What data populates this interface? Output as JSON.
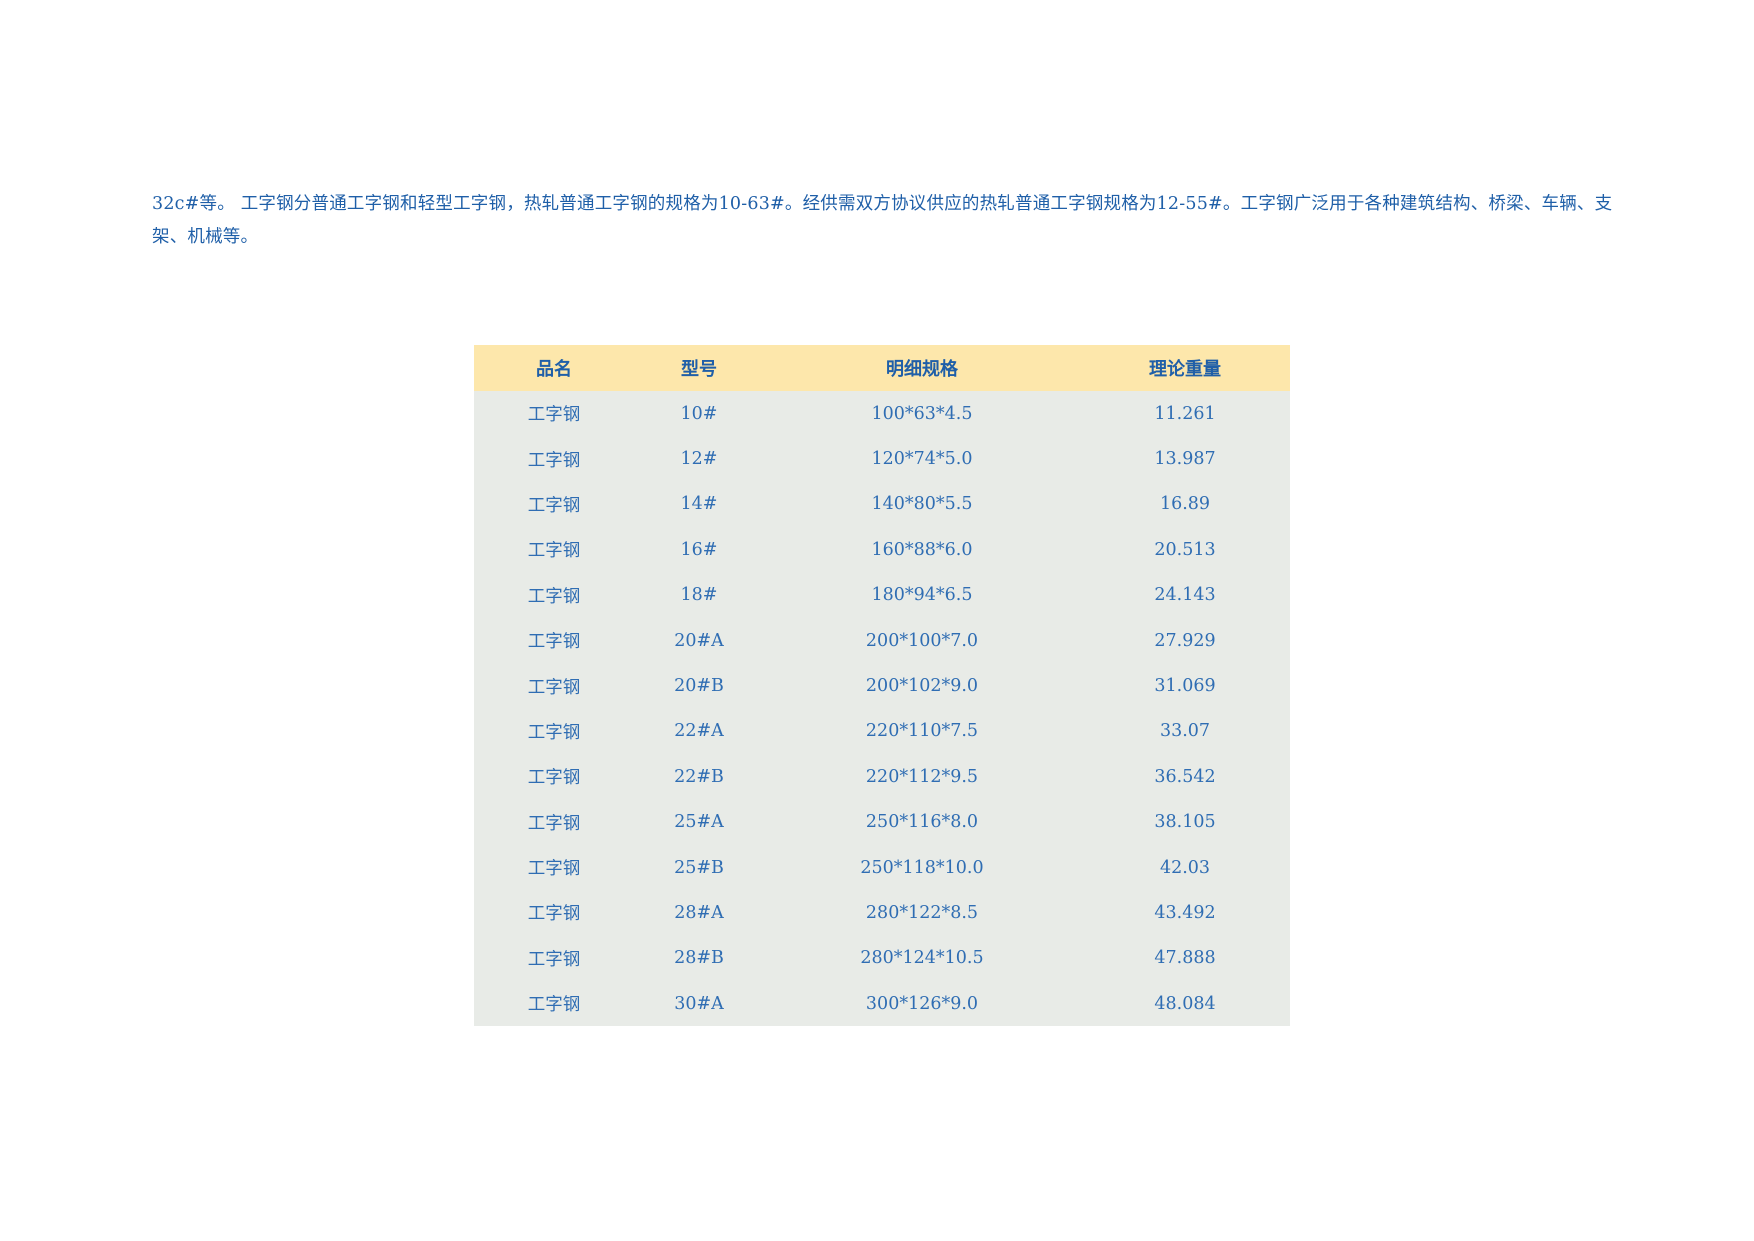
{
  "intro": {
    "text": "32c#等。 工字钢分普通工字钢和轻型工字钢，热轧普通工字钢的规格为10-63#。经供需双方协议供应的热轧普通工字钢规格为12-55#。工字钢广泛用于各种建筑结构、桥梁、车辆、支架、机械等。"
  },
  "table": {
    "headers": [
      "品名",
      "型号",
      "明细规格",
      "理论重量"
    ],
    "rows": [
      [
        "工字钢",
        "10#",
        "100*63*4.5",
        "11.261"
      ],
      [
        "工字钢",
        "12#",
        "120*74*5.0",
        "13.987"
      ],
      [
        "工字钢",
        "14#",
        "140*80*5.5",
        "16.89"
      ],
      [
        "工字钢",
        "16#",
        "160*88*6.0",
        "20.513"
      ],
      [
        "工字钢",
        "18#",
        "180*94*6.5",
        "24.143"
      ],
      [
        "工字钢",
        "20#A",
        "200*100*7.0",
        "27.929"
      ],
      [
        "工字钢",
        "20#B",
        "200*102*9.0",
        "31.069"
      ],
      [
        "工字钢",
        "22#A",
        "220*110*7.5",
        "33.07"
      ],
      [
        "工字钢",
        "22#B",
        "220*112*9.5",
        "36.542"
      ],
      [
        "工字钢",
        "25#A",
        "250*116*8.0",
        "38.105"
      ],
      [
        "工字钢",
        "25#B",
        "250*118*10.0",
        "42.03"
      ],
      [
        "工字钢",
        "28#A",
        "280*122*8.5",
        "43.492"
      ],
      [
        "工字钢",
        "28#B",
        "280*124*10.5",
        "47.888"
      ],
      [
        "工字钢",
        "30#A",
        "300*126*9.0",
        "48.084"
      ]
    ]
  },
  "colors": {
    "text": "#1f5fa8",
    "header_bg": "#fde7ab",
    "row_bg": "#e8ebe7"
  }
}
